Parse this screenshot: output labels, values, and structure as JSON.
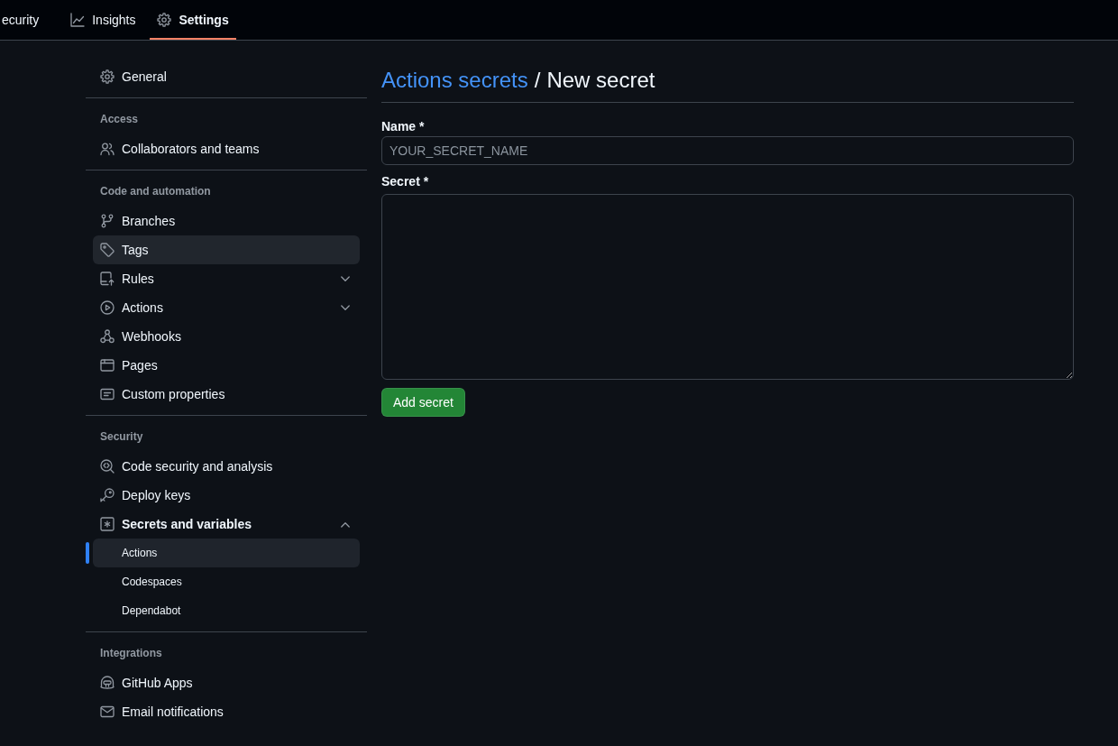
{
  "top_nav": {
    "tabs": [
      {
        "label": "ecurity",
        "selected": false
      },
      {
        "label": "Insights",
        "selected": false
      },
      {
        "label": "Settings",
        "selected": true
      }
    ]
  },
  "sidebar": {
    "sections": [
      {
        "items": [
          {
            "label": "General",
            "selected": false,
            "hovered": false
          }
        ]
      },
      {
        "heading": "Access",
        "items": [
          {
            "label": "Collaborators and teams",
            "selected": false,
            "hovered": false
          }
        ]
      },
      {
        "heading": "Code and automation",
        "items": [
          {
            "label": "Branches",
            "selected": false,
            "hovered": false
          },
          {
            "label": "Tags",
            "selected": false,
            "hovered": true
          },
          {
            "label": "Rules",
            "selected": false,
            "hovered": false,
            "expanded": false
          },
          {
            "label": "Actions",
            "selected": false,
            "hovered": false,
            "expanded": false
          },
          {
            "label": "Webhooks",
            "selected": false,
            "hovered": false
          },
          {
            "label": "Pages",
            "selected": false,
            "hovered": false
          },
          {
            "label": "Custom properties",
            "selected": false,
            "hovered": false
          }
        ]
      },
      {
        "heading": "Security",
        "items": [
          {
            "label": "Code security and analysis",
            "selected": false,
            "hovered": false
          },
          {
            "label": "Deploy keys",
            "selected": false,
            "hovered": false
          },
          {
            "label": "Secrets and variables",
            "selected": false,
            "hovered": false,
            "expanded": true,
            "children": [
              {
                "label": "Actions",
                "selected": true
              },
              {
                "label": "Codespaces",
                "selected": false
              },
              {
                "label": "Dependabot",
                "selected": false
              }
            ]
          }
        ]
      },
      {
        "heading": "Integrations",
        "items": [
          {
            "label": "GitHub Apps",
            "selected": false,
            "hovered": false
          },
          {
            "label": "Email notifications",
            "selected": false,
            "hovered": false
          }
        ]
      }
    ]
  },
  "main": {
    "breadcrumb": {
      "link": "Actions secrets",
      "separator": "/",
      "current": "New secret"
    },
    "form": {
      "fields": [
        {
          "kind": "input",
          "label": "Name *",
          "placeholder": "YOUR_SECRET_NAME"
        },
        {
          "kind": "textarea",
          "label": "Secret *"
        }
      ],
      "submit": "Add secret"
    }
  }
}
